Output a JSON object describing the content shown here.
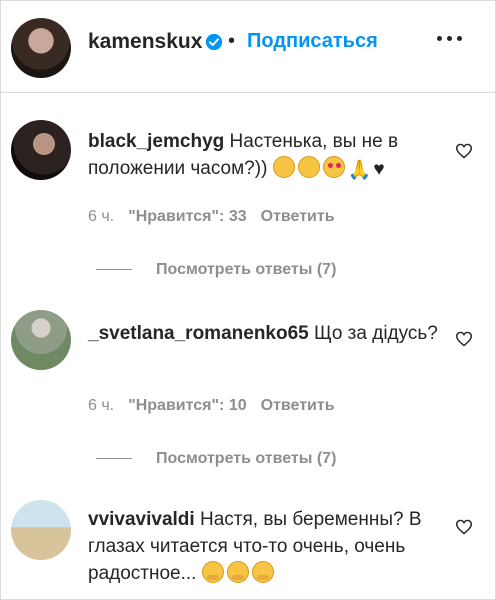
{
  "header": {
    "username": "kamenskux",
    "separator": "•",
    "follow_label": "Подписаться"
  },
  "comments": [
    {
      "username": "black_jemchyg",
      "text": "Настенька, вы не в положении часом?))",
      "time": "6 ч.",
      "likes": "\"Нравится\": 33",
      "reply_label": "Ответить",
      "view_replies": "Посмотреть ответы (7)"
    },
    {
      "username": "_svetlana_romanenko65",
      "text": "Що за дідусь?",
      "time": "6 ч.",
      "likes": "\"Нравится\": 10",
      "reply_label": "Ответить",
      "view_replies": "Посмотреть ответы (7)"
    },
    {
      "username": "vvivavivaldi",
      "text": "Настя, вы беременны? В глазах читается что-то очень, очень радостное..."
    }
  ],
  "icons": {
    "verified": "verified-badge-icon",
    "more": "more-options-icon",
    "like": "heart-outline-icon"
  },
  "colors": {
    "accent": "#0095f6",
    "muted": "#8e8e8e",
    "text": "#262626"
  }
}
